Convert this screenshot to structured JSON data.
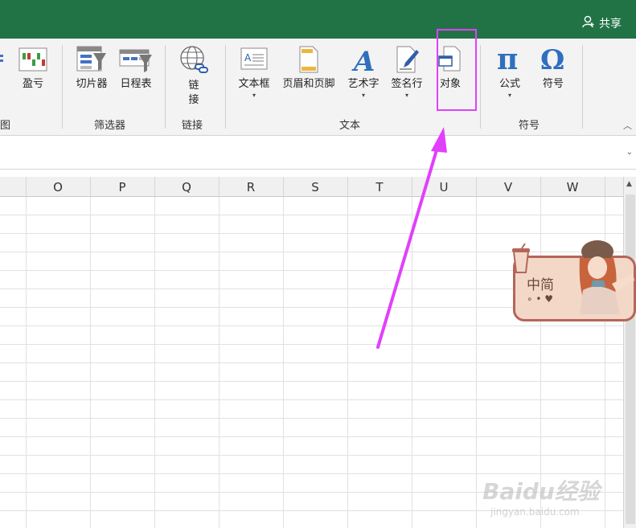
{
  "header": {
    "share_label": "共享"
  },
  "ribbon": {
    "partial_left_label": "图",
    "buttons": [
      {
        "id": "winloss",
        "label": "盈亏"
      },
      {
        "id": "slicer",
        "label": "切片器"
      },
      {
        "id": "timeline",
        "label": "日程表"
      },
      {
        "id": "link",
        "label_line1": "链",
        "label_line2": "接"
      },
      {
        "id": "textbox",
        "label": "文本框"
      },
      {
        "id": "header_footer",
        "label": "页眉和页脚"
      },
      {
        "id": "wordart",
        "label": "艺术字"
      },
      {
        "id": "signature",
        "label": "签名行"
      },
      {
        "id": "object",
        "label": "对象"
      },
      {
        "id": "equation",
        "label": "公式"
      },
      {
        "id": "symbol",
        "label": "符号"
      }
    ],
    "groups": {
      "filter": "筛选器",
      "links": "链接",
      "text": "文本",
      "symbols": "符号"
    },
    "colors": {
      "accent_green": "#217346",
      "highlight": "#e040fb"
    }
  },
  "sheet": {
    "columns": [
      "O",
      "P",
      "Q",
      "R",
      "S",
      "T",
      "U",
      "V",
      "W"
    ]
  },
  "sticker": {
    "text": "中简"
  },
  "watermark": {
    "brand": "Baidu经验",
    "url": "jingyan.baidu.com"
  }
}
